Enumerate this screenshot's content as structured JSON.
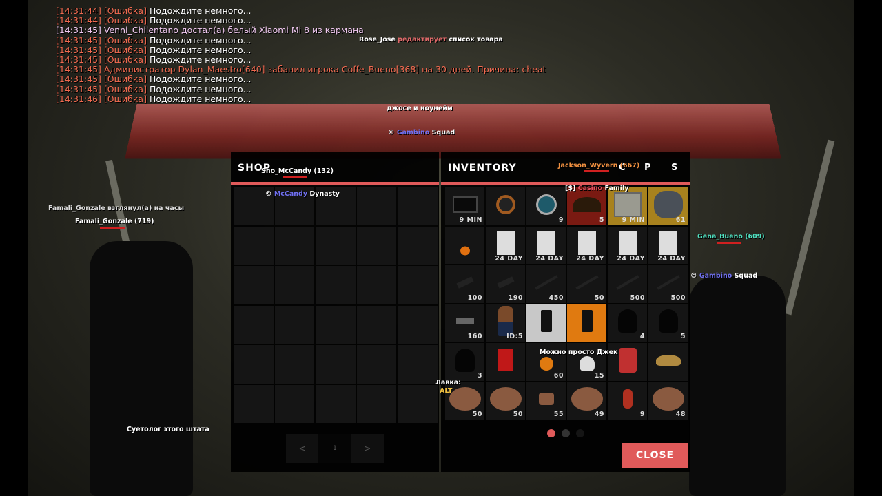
{
  "chat": [
    {
      "time": "[14:31:44]",
      "tag": "[Ошибка]",
      "text": "Подождите немного...",
      "type": "error"
    },
    {
      "time": "[14:31:44]",
      "tag": "[Ошибка]",
      "text": "Подождите немного...",
      "type": "error"
    },
    {
      "time": "[14:31:45]",
      "tag": "",
      "text": "Venni_Chilentano достал(а) белый Xiaomi Mi 8 из кармана",
      "type": "me"
    },
    {
      "time": "[14:31:45]",
      "tag": "[Ошибка]",
      "text": "Подождите немного...",
      "type": "error"
    },
    {
      "time": "[14:31:45]",
      "tag": "[Ошибка]",
      "text": "Подождите немного...",
      "type": "error"
    },
    {
      "time": "[14:31:45]",
      "tag": "[Ошибка]",
      "text": "Подождите немного...",
      "type": "error"
    },
    {
      "time": "[14:31:45]",
      "tag": "",
      "text": "Администратор Dylan_Maestro[640] забанил игрока Coffe_Bueno[368] на 30 дней. Причина: cheat",
      "type": "admin"
    },
    {
      "time": "[14:31:45]",
      "tag": "[Ошибка]",
      "text": "Подождите немного...",
      "type": "error"
    },
    {
      "time": "[14:31:45]",
      "tag": "[Ошибка]",
      "text": "Подождите немного...",
      "type": "error"
    },
    {
      "time": "[14:31:46]",
      "tag": "[Ошибка]",
      "text": "Подождите немного...",
      "type": "error"
    }
  ],
  "world": {
    "rose_name": "Rose_Jose",
    "rose_action": "редактирует",
    "rose_rest": "список товара",
    "djoys": "джосе и ноунейм",
    "gambino1_c": "©",
    "gambino1_a": "Gambino",
    "gambino1_b": "Squad",
    "famali_action": "Famali_Gonzale взглянул(а) на часы",
    "famali_name": "Famali_Gonzale (719)",
    "sho_name": "Sho_McCandy (132)",
    "mccandy_c": "©",
    "mccandy_a": "McCandy",
    "mccandy_b": "Dynasty",
    "jackson_name": "Jackson_Wyvern (667)",
    "casino_a": "[$]",
    "casino_b": "Casino",
    "casino_c": "Family",
    "gena_name": "Gena_Bueno (609)",
    "gambino2_c": "©",
    "gambino2_a": "Gambino",
    "gambino2_b": "Squad",
    "jack": "Можно просто Джек",
    "lavka": "Лавка:",
    "alt": "ALT",
    "suetolog": "Суетолог этого штата"
  },
  "shop": {
    "title": "SHOP",
    "pager": {
      "prev": "<",
      "page": "1",
      "next": ">"
    }
  },
  "inventory": {
    "title": "INVENTORY",
    "tab_c": "C",
    "tab_p": "P",
    "tab_s": "S",
    "close_label": "CLOSE",
    "pages": 3,
    "active_page": 1,
    "colors": {
      "accent": "#e05a5a",
      "red": "#7a1a12",
      "gold": "#a8821e",
      "light": "#c8c8c8",
      "orange": "#e07a10"
    },
    "items": [
      {
        "icon": "box-icon",
        "count": "9 MIN",
        "bg": ""
      },
      {
        "icon": "chip-icon",
        "count": "",
        "bg": ""
      },
      {
        "icon": "chip-blue-icon",
        "count": "9",
        "bg": ""
      },
      {
        "icon": "statue-icon",
        "count": "5",
        "bg": "red"
      },
      {
        "icon": "crate-icon",
        "count": "9 MIN",
        "bg": "gold"
      },
      {
        "icon": "stone-icon",
        "count": "61",
        "bg": "gold"
      },
      {
        "icon": "pumpkin-icon",
        "count": "",
        "bg": ""
      },
      {
        "icon": "document-icon",
        "count": "24 DAY",
        "bg": ""
      },
      {
        "icon": "document-icon",
        "count": "24 DAY",
        "bg": ""
      },
      {
        "icon": "document-icon",
        "count": "24 DAY",
        "bg": ""
      },
      {
        "icon": "document-icon",
        "count": "24 DAY",
        "bg": ""
      },
      {
        "icon": "document-icon",
        "count": "24 DAY",
        "bg": ""
      },
      {
        "icon": "pistol-icon",
        "count": "100",
        "bg": ""
      },
      {
        "icon": "pistol-icon",
        "count": "190",
        "bg": ""
      },
      {
        "icon": "rifle-icon",
        "count": "450",
        "bg": ""
      },
      {
        "icon": "rifle-icon",
        "count": "50",
        "bg": ""
      },
      {
        "icon": "rifle-icon",
        "count": "500",
        "bg": ""
      },
      {
        "icon": "rifle-icon",
        "count": "500",
        "bg": ""
      },
      {
        "icon": "uzi-icon",
        "count": "160",
        "bg": ""
      },
      {
        "icon": "skin-icon",
        "count": "ID:5",
        "bg": ""
      },
      {
        "icon": "phone-icon",
        "count": "",
        "bg": "light"
      },
      {
        "icon": "phone-icon",
        "count": "",
        "bg": "orange"
      },
      {
        "icon": "mask-icon",
        "count": "4",
        "bg": ""
      },
      {
        "icon": "mask-icon",
        "count": "5",
        "bg": ""
      },
      {
        "icon": "mask-icon",
        "count": "3",
        "bg": ""
      },
      {
        "icon": "canister-icon",
        "count": "",
        "bg": ""
      },
      {
        "icon": "soup-icon",
        "count": "60",
        "bg": ""
      },
      {
        "icon": "skull-icon",
        "count": "15",
        "bg": ""
      },
      {
        "icon": "meat-icon",
        "count": "",
        "bg": ""
      },
      {
        "icon": "hat-icon",
        "count": "",
        "bg": ""
      },
      {
        "icon": "steak-icon",
        "count": "50",
        "bg": ""
      },
      {
        "icon": "steak-icon",
        "count": "50",
        "bg": ""
      },
      {
        "icon": "bread-icon",
        "count": "55",
        "bg": ""
      },
      {
        "icon": "steak-icon",
        "count": "49",
        "bg": ""
      },
      {
        "icon": "bottle-icon",
        "count": "9",
        "bg": ""
      },
      {
        "icon": "steak-icon",
        "count": "48",
        "bg": ""
      }
    ]
  }
}
